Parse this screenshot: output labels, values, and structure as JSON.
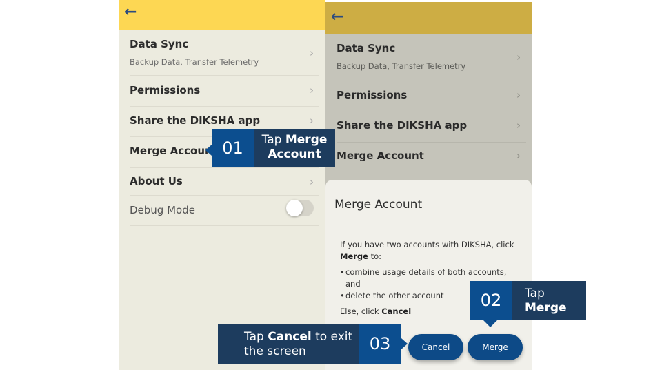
{
  "left_screen": {
    "menu": [
      {
        "title": "Data Sync",
        "subtitle": "Backup Data, Transfer Telemetry"
      },
      {
        "title": "Permissions"
      },
      {
        "title": "Share the DIKSHA app"
      },
      {
        "title": "Merge Account"
      },
      {
        "title": "About Us"
      },
      {
        "title": "Debug Mode"
      }
    ],
    "debug_mode_on": false
  },
  "right_screen": {
    "menu": [
      {
        "title": "Data Sync",
        "subtitle": "Backup Data, Transfer Telemetry"
      },
      {
        "title": "Permissions"
      },
      {
        "title": "Share the DIKSHA app"
      },
      {
        "title": "Merge Account"
      }
    ],
    "dialog": {
      "title": "Merge Account",
      "intro_prefix": "If you have two accounts with DIKSHA, click ",
      "intro_bold": "Merge",
      "intro_suffix": " to:",
      "bullets": [
        "combine usage details of both accounts, and",
        "delete the other account"
      ],
      "else_prefix": "Else, click ",
      "else_bold": "Cancel",
      "cancel_label": "Cancel",
      "merge_label": "Merge"
    }
  },
  "callouts": {
    "step1": {
      "number": "01",
      "prefix": "Tap ",
      "bold": "Merge Account"
    },
    "step2": {
      "number": "02",
      "prefix": "Tap",
      "bold": "Merge"
    },
    "step3": {
      "number": "03",
      "prefix": "Tap ",
      "bold": "Cancel",
      "suffix": " to exit the screen"
    }
  },
  "colors": {
    "top_bar": "#fdd753",
    "top_bar_dimmed": "#cdad44",
    "primary_button": "#0d4a87",
    "callout_number": "#0c4e8f",
    "callout_text": "#1d3c5e"
  }
}
